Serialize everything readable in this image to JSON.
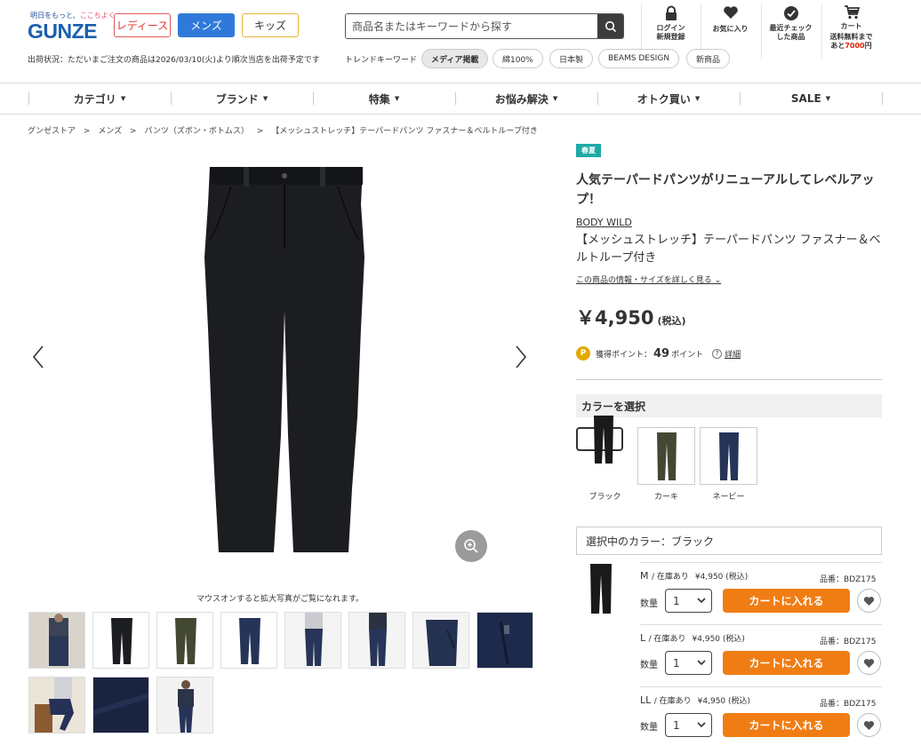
{
  "header": {
    "tagline_a": "明日をもっと、",
    "tagline_hl": "ここちよく",
    "logo": "GUNZE",
    "gender_tabs": [
      "レディース",
      "メンズ",
      "キッズ"
    ],
    "search_placeholder": "商品名またはキーワードから探す",
    "icons": {
      "login": {
        "l1": "ログイン",
        "l2": "新規登録"
      },
      "favorites": {
        "l1": "お気に入り"
      },
      "recent": {
        "l1": "最近チェック",
        "l2": "した商品"
      },
      "cart": {
        "l1": "カート",
        "l2": "送料無料まで",
        "l3_pre": "あと",
        "l3_val": "7000",
        "l3_post": "円"
      }
    },
    "ship_status": "出荷状況：ただいまご注文の商品は2026/03/10(火)より順次当店を出荷予定です",
    "trend_label": "トレンドキーワード",
    "trend_keywords": [
      "メディア掲載",
      "綿100%",
      "日本製",
      "BEAMS DESIGN",
      "新商品"
    ]
  },
  "nav": [
    "カテゴリ",
    "ブランド",
    "特集",
    "お悩み解決",
    "オトク買い",
    "SALE"
  ],
  "breadcrumb": [
    "グンゼストア",
    ">",
    "メンズ",
    ">",
    "パンツ（ズボン・ボトムス）",
    ">",
    "【メッシュストレッチ】テーパードパンツ ファスナー＆ベルトループ付き"
  ],
  "gallery": {
    "hint": "マウスオンすると拡大写真がご覧になれます。"
  },
  "product": {
    "season": "春夏",
    "catch": "人気テーパードパンツがリニューアルしてレベルアップ！",
    "brand": "BODY WILD",
    "name": "【メッシュストレッチ】テーパードパンツ ファスナー＆ベルトループ付き",
    "info_link": "この商品の情報・サイズを詳しく見る",
    "price": "￥4,950",
    "tax": "(税込)",
    "points_label": "獲得ポイント：",
    "points": "49",
    "points_unit": "ポイント",
    "detail_link": "詳細",
    "color_heading": "カラーを選択",
    "colors": [
      {
        "name": "ブラック",
        "hex": "#1a1a1a"
      },
      {
        "name": "カーキ",
        "hex": "#434833"
      },
      {
        "name": "ネービー",
        "hex": "#263458"
      }
    ],
    "selected_color": "選択中のカラー：ブラック",
    "sizes": [
      {
        "label": "M",
        "stock": "/ 在庫あり",
        "price": "¥4,950 (税込)",
        "code_label": "品番：",
        "code": "BDZ175",
        "qty_label": "数量",
        "qty": "1",
        "cart": "カートに入れる"
      },
      {
        "label": "L",
        "stock": "/ 在庫あり",
        "price": "¥4,950 (税込)",
        "code_label": "品番：",
        "code": "BDZ175",
        "qty_label": "数量",
        "qty": "1",
        "cart": "カートに入れる"
      },
      {
        "label": "LL",
        "stock": "/ 在庫あり",
        "price": "¥4,950 (税込)",
        "code_label": "品番：",
        "code": "BDZ175",
        "qty_label": "数量",
        "qty": "1",
        "cart": "カートに入れる"
      }
    ]
  }
}
